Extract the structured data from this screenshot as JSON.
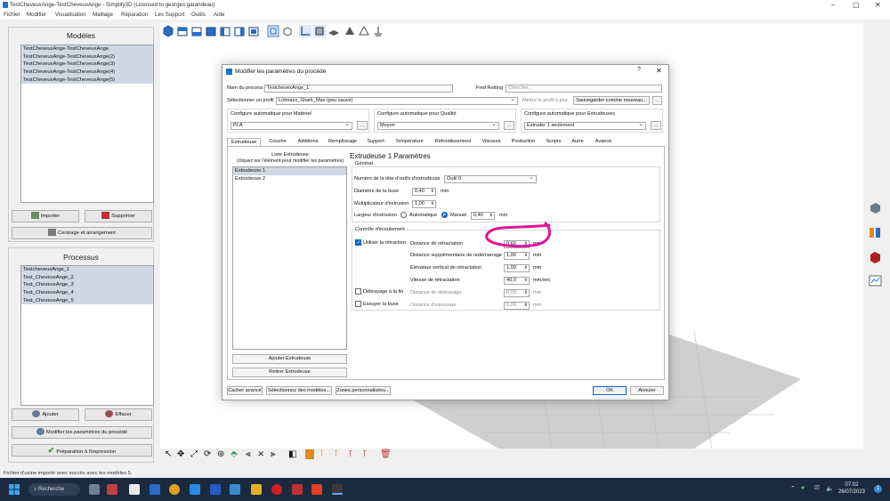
{
  "window": {
    "title": "TestCheveuxAnge-TestCheveuxAnge - Simplify3D (Licensed to georges garandeau)",
    "controls": [
      "–",
      "▢",
      "✕"
    ]
  },
  "menu": [
    "Fichier",
    "Modifier",
    "Visualisation",
    "Maillage",
    "Réparation",
    "Les Support",
    "Outils",
    "Aide"
  ],
  "models": {
    "title": "Modèles",
    "items": [
      "TestCheveuxAnge-TestCheveuxAnge",
      "TestCheveuxAnge-TestCheveuxAnge(2)",
      "TestCheveuxAnge-TestCheveuxAnge(3)",
      "TestCheveuxAnge-TestCheveuxAnge(4)",
      "TestCheveuxAnge-TestCheveuxAnge(5)"
    ],
    "import_label": "Importer",
    "delete_label": "Supprimer",
    "center_label": "Centrage et arrangement"
  },
  "processes": {
    "title": "Processus",
    "items": [
      "TestcheveuxAnge_1",
      "Test_CheveuxAnge_2",
      "Test_CheveuxAnge_3",
      "Test_CheveuxAnge_4",
      "Test_CheveuxAnge_5"
    ],
    "add_label": "Ajouter",
    "remove_label": "Effacer",
    "edit_label": "Modifier les paramètres du procédé",
    "prepare_label": "Préparation à l'impression"
  },
  "dialog": {
    "title": "Modifier les paramètres du procédé",
    "help": "?",
    "close": "✕",
    "process_name_label": "Nom du process",
    "process_name_value": "TestchevexAnge_1",
    "find_label": "Find Retting:",
    "find_placeholder": "Chercher...",
    "profile_label": "Sélectionner un profil",
    "profile_value": "Lotmaxx_Shark_Max (peu sauvé)",
    "update_profile_label": "Mettre le profil à jour",
    "save_as_label": "Sauvegarder comme nouveau...",
    "more": "...",
    "material_label": "Configure automatique pour Matériel",
    "material_value": "PLA",
    "quality_label": "Configure automatique pour Qualité",
    "quality_value": "Moyen",
    "extruders_label": "Configure automatique pour Extrudeuses",
    "extruders_value": "Extruder 1 seulement",
    "tabs": [
      "Extrudeuse",
      "Couche",
      "Additions",
      "Remplissage",
      "Support",
      "Température",
      "Refroidissement",
      "Vitesses",
      "Production",
      "Scripts",
      "Autre",
      "Avancé"
    ],
    "extruder_list_title": "Liste Extrudeuse",
    "extruder_list_hint": "(cliquez sur l'élément pour modifier les paramètres)",
    "extruders": [
      "Extrudeuse 1",
      "Extrudeuse 2"
    ],
    "add_extruder": "Ajouter Extrudeuse",
    "remove_extruder": "Retirer Extrudeuse",
    "params_title": "Extrudeuse 1 Paramètres",
    "general_label": "Général",
    "tool_head_label": "Numéro de la tête d'outils d'extrudeuse",
    "tool_head_value": "Outil 0",
    "nozzle_label": "Diamètre de la buse",
    "nozzle_value": "0,40",
    "multiplier_label": "Multiplicateur d'extrusion",
    "multiplier_value": "1,00",
    "width_label": "Largeur d'extrusion",
    "auto_label": "Automatique",
    "manual_label": "Manuel",
    "width_value": "0,40",
    "unit_mm": "mm",
    "unit_mmsec": "mm/sec",
    "ooze_label": "Contrôle d'écoulement",
    "use_retraction_label": "Utiliser la rétraction",
    "retraction_distance_label": "Distance de rétractation",
    "retraction_distance_value": "0,60",
    "extra_restart_label": "Distance supplémentaire de redémarrage",
    "extra_restart_value": "1,00",
    "vertical_lift_label": "Elévateur vertical de rétractation",
    "vertical_lift_value": "1,00",
    "retraction_speed_label": "Vitesse de rétractation",
    "retraction_speed_value": "40,0",
    "coast_label": "Débrayage à la fin",
    "coast_distance_label": "Distance de débrayage",
    "coast_distance_value": "0,20",
    "wipe_label": "Essuyer la buse",
    "wipe_distance_label": "Distance d'essuyage",
    "wipe_distance_value": "5,00",
    "hide_advanced": "Cacher avancé",
    "select_models": "Sélectionnez des modèles...",
    "custom_zones": "Zones personnalisées...",
    "ok": "OK",
    "cancel": "Annuler"
  },
  "status_text": "Fichier d'usine importé avec succès avec les modèles 5.",
  "taskbar": {
    "search_label": "Recherche",
    "time": "07:02",
    "date": "26/07/2023",
    "notification_count": "1"
  },
  "colors": {
    "accent": "#0a63c9",
    "annotation": "#e0159a",
    "taskbar": "#1b2a3f"
  }
}
